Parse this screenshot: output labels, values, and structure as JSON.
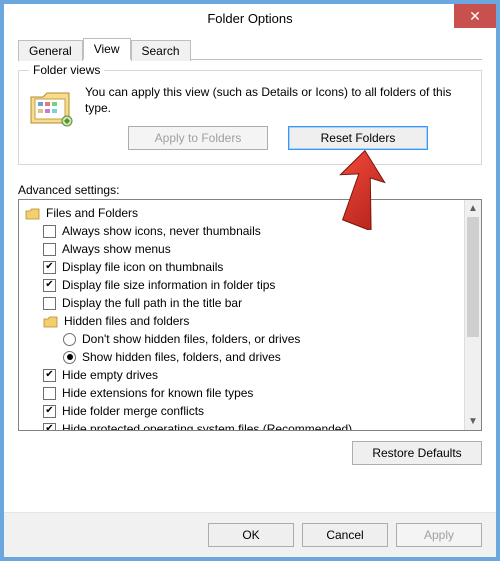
{
  "title": "Folder Options",
  "tabs": {
    "general": "General",
    "view": "View",
    "search": "Search"
  },
  "folderViews": {
    "legend": "Folder views",
    "text": "You can apply this view (such as Details or Icons) to all folders of this type.",
    "applyBtn": "Apply to Folders",
    "resetBtn": "Reset Folders"
  },
  "advancedLabel": "Advanced settings:",
  "tree": {
    "root": "Files and Folders",
    "alwaysIcons": "Always show icons, never thumbnails",
    "alwaysMenus": "Always show menus",
    "iconOnThumb": "Display file icon on thumbnails",
    "sizeTips": "Display file size information in folder tips",
    "fullPath": "Display the full path in the title bar",
    "hiddenGroup": "Hidden files and folders",
    "dontShowHidden": "Don't show hidden files, folders, or drives",
    "showHidden": "Show hidden files, folders, and drives",
    "hideEmpty": "Hide empty drives",
    "hideExt": "Hide extensions for known file types",
    "hideMerge": "Hide folder merge conflicts",
    "hideProtected": "Hide protected operating system files (Recommended)"
  },
  "restoreDefaults": "Restore Defaults",
  "footer": {
    "ok": "OK",
    "cancel": "Cancel",
    "apply": "Apply"
  }
}
